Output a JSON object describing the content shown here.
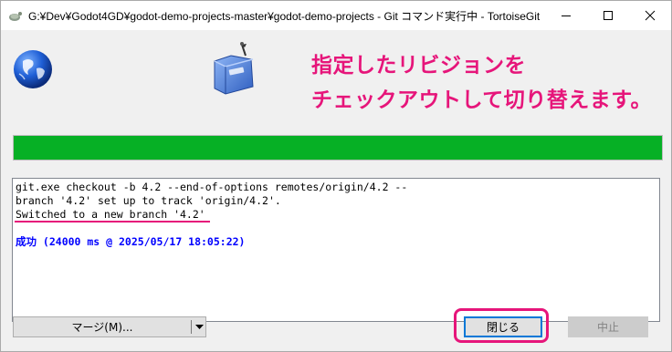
{
  "window": {
    "title": "G:¥Dev¥Godot4GD¥godot-demo-projects-master¥godot-demo-projects - Git コマンド実行中 - TortoiseGit"
  },
  "annotation": {
    "line1": "指定したリビジョンを",
    "line2": "チェックアウトして切り替えます。",
    "color": "#e6157a"
  },
  "progress": {
    "fraction": 1.0,
    "color": "#06b025"
  },
  "log": {
    "lines": [
      "git.exe checkout -b 4.2 --end-of-options remotes/origin/4.2 --",
      "branch '4.2' set up to track 'origin/4.2'.",
      "Switched to a new branch '4.2'"
    ],
    "result": "成功 (24000 ms @ 2025/05/17 18:05:22)"
  },
  "buttons": {
    "merge": "マージ(M)...",
    "close": "閉じる",
    "stop": "中止"
  }
}
